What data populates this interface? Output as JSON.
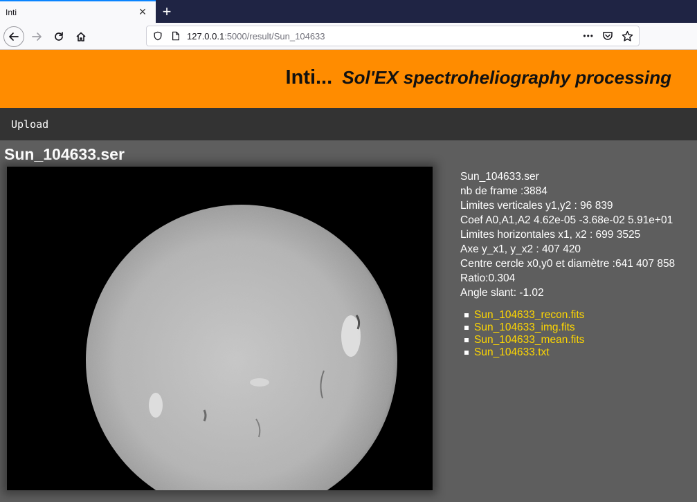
{
  "browser": {
    "tab_title": "Inti",
    "tab_close": "×",
    "new_tab": "+",
    "url_host": "127.0.0.1",
    "url_path": ":5000/result/Sun_104633",
    "url_actions": "•••"
  },
  "header": {
    "title": "Inti...",
    "subtitle": "Sol'EX spectroheliography processing"
  },
  "menu": {
    "items": [
      "Upload"
    ]
  },
  "page": {
    "title": "Sun_104633.ser"
  },
  "info": {
    "lines": [
      "Sun_104633.ser",
      "nb de frame :3884",
      "Limites verticales y1,y2 : 96 839",
      "Coef A0,A1,A2 4.62e-05 -3.68e-02 5.91e+01",
      "Limites horizontales x1, x2 : 699 3525",
      "Axe y_x1, y_x2 : 407 420",
      "Centre cercle x0,y0 et diamètre :641 407 858",
      "Ratio:0.304",
      "Angle slant: -1.02"
    ]
  },
  "files": [
    "Sun_104633_recon.fits",
    "Sun_104633_img.fits",
    "Sun_104633_mean.fits",
    "Sun_104633.txt"
  ],
  "colors": {
    "header_bg": "#ff8c00",
    "menu_bg": "#333333",
    "page_bg": "#5e5e5e",
    "link": "#ffd700"
  }
}
